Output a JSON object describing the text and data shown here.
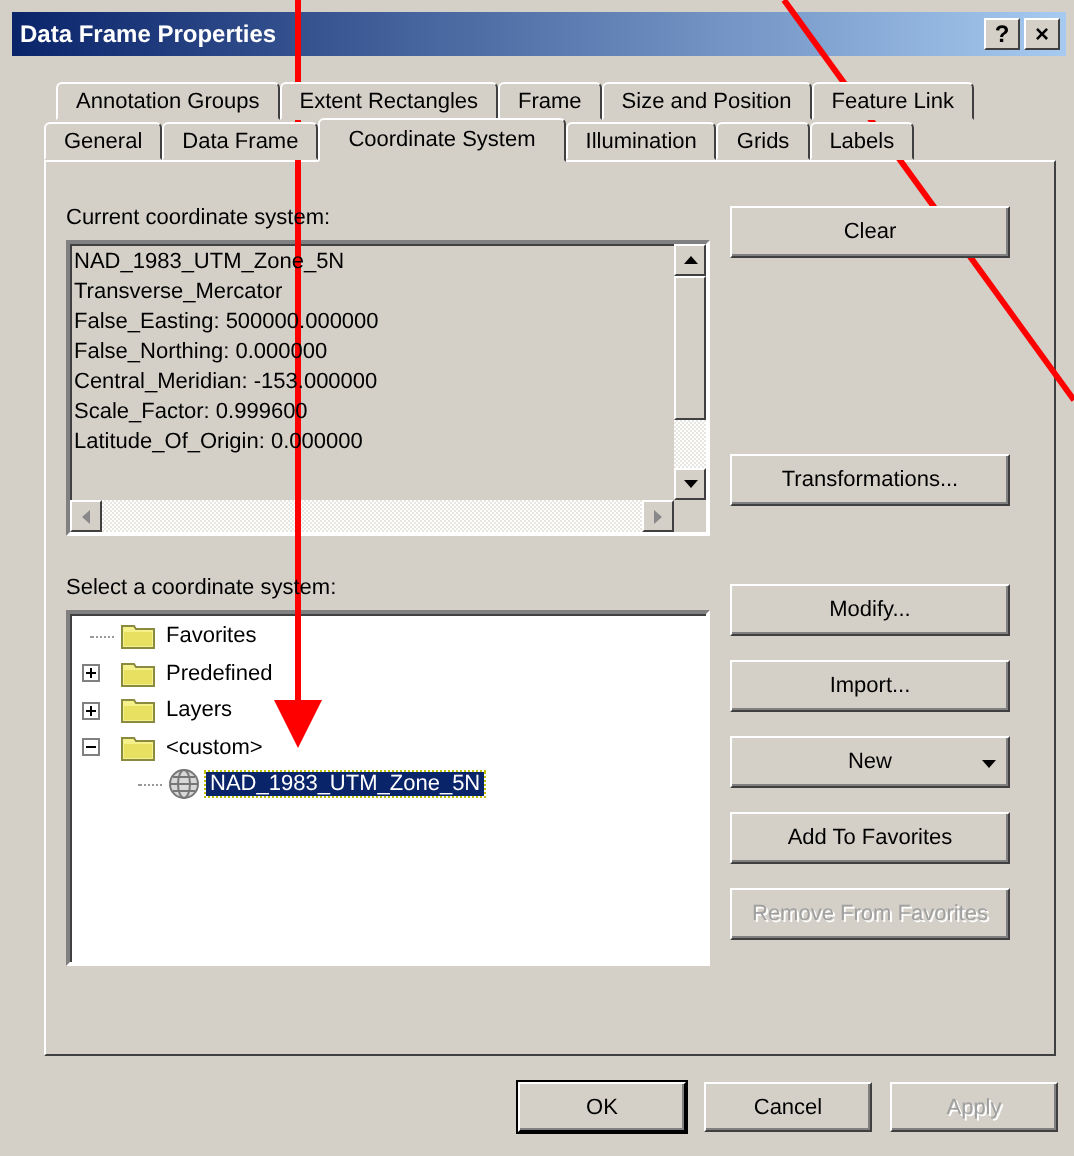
{
  "window": {
    "title": "Data Frame Properties",
    "title_buttons": [
      "?",
      "×"
    ]
  },
  "tab_rows": [
    {
      "tabs": [
        {
          "label": "Annotation Groups",
          "selected": false
        },
        {
          "label": "Extent Rectangles",
          "selected": false
        },
        {
          "label": "Frame",
          "selected": false
        },
        {
          "label": "Size and Position",
          "selected": false
        },
        {
          "label": "Feature Link",
          "selected": false
        }
      ]
    },
    {
      "tabs": [
        {
          "label": "General",
          "selected": false
        },
        {
          "label": "Data Frame",
          "selected": false
        },
        {
          "label": "Coordinate System",
          "selected": true
        },
        {
          "label": "Illumination",
          "selected": false
        },
        {
          "label": "Grids",
          "selected": false
        },
        {
          "label": "Labels",
          "selected": false
        }
      ]
    }
  ],
  "current_system": {
    "label": "Current coordinate system:",
    "lines": [
      "NAD_1983_UTM_Zone_5N",
      "Transverse_Mercator",
      "False_Easting: 500000.000000",
      "False_Northing: 0.000000",
      "Central_Meridian: -153.000000",
      "Scale_Factor: 0.999600",
      "Latitude_Of_Origin: 0.000000"
    ],
    "buttons": [
      {
        "label": "Clear",
        "kind": "plain",
        "disabled": false
      },
      {
        "label": "Transformations...",
        "kind": "plain",
        "disabled": false
      }
    ]
  },
  "select_system": {
    "label": "Select a coordinate system:",
    "tree": [
      {
        "label": "Favorites",
        "kind": "folder",
        "has_children": false,
        "selected": false
      },
      {
        "label": "Predefined",
        "kind": "folder",
        "has_children": true,
        "expanded": false,
        "selected": false
      },
      {
        "label": "Layers",
        "kind": "folder",
        "has_children": true,
        "expanded": false,
        "selected": false
      },
      {
        "label": "<custom>",
        "kind": "folder",
        "has_children": true,
        "expanded": true,
        "selected": false,
        "children": [
          {
            "label": "NAD_1983_UTM_Zone_5N",
            "kind": "globe",
            "has_children": false,
            "selected": true
          }
        ]
      }
    ],
    "buttons": [
      {
        "label": "Modify...",
        "kind": "plain",
        "disabled": false
      },
      {
        "label": "Import...",
        "kind": "plain",
        "disabled": false
      },
      {
        "label": "New",
        "kind": "dropdown",
        "disabled": false
      },
      {
        "label": "Add To Favorites",
        "kind": "plain",
        "disabled": false
      },
      {
        "label": "Remove From Favorites",
        "kind": "plain",
        "disabled": true
      }
    ]
  },
  "dialog_buttons": [
    {
      "label": "OK",
      "default": true,
      "disabled": false
    },
    {
      "label": "Cancel",
      "default": false,
      "disabled": false
    },
    {
      "label": "Apply",
      "default": false,
      "disabled": true
    }
  ],
  "annotations": [
    {
      "kind": "arrow"
    },
    {
      "kind": "line"
    }
  ]
}
